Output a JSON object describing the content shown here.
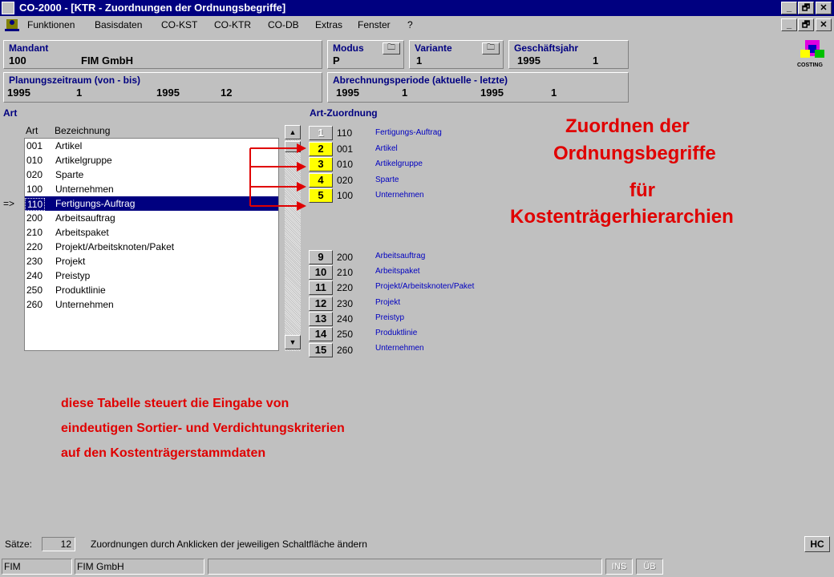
{
  "window": {
    "title": "CO-2000 - [KTR - Zuordnungen der Ordnungsbegriffe]",
    "min": "_",
    "max": "🗗",
    "close": "✕"
  },
  "menu": [
    "Funktionen",
    "Basisdaten",
    "CO-KST",
    "CO-KTR",
    "CO-DB",
    "Extras",
    "Fenster",
    "?"
  ],
  "header": {
    "mandant_label": "Mandant",
    "mandant_id": "100",
    "mandant_name": "FIM GmbH",
    "modus_label": "Modus",
    "modus_value": "P",
    "variante_label": "Variante",
    "variante_value": "1",
    "gj_label": "Geschäftsjahr",
    "gj_year": "1995",
    "gj_value": "1",
    "pz_label": "Planungszeitraum (von - bis)",
    "pz_from_year": "1995",
    "pz_from": "1",
    "pz_to_year": "1995",
    "pz_to": "12",
    "ap_label": "Abrechnungsperiode (aktuelle - letzte)",
    "ap_cur_year": "1995",
    "ap_cur": "1",
    "ap_last_year": "1995",
    "ap_last": "1",
    "logo_text": "COSTING"
  },
  "art": {
    "label": "Art",
    "col_art": "Art",
    "col_bez": "Bezeichnung",
    "marker": "=>",
    "rows": [
      {
        "code": "001",
        "name": "Artikel"
      },
      {
        "code": "010",
        "name": "Artikelgruppe"
      },
      {
        "code": "020",
        "name": "Sparte"
      },
      {
        "code": "100",
        "name": "Unternehmen"
      },
      {
        "code": "110",
        "name": "Fertigungs-Auftrag"
      },
      {
        "code": "200",
        "name": "Arbeitsauftrag"
      },
      {
        "code": "210",
        "name": "Arbeitspaket"
      },
      {
        "code": "220",
        "name": "Projekt/Arbeitsknoten/Paket"
      },
      {
        "code": "230",
        "name": "Projekt"
      },
      {
        "code": "240",
        "name": "Preistyp"
      },
      {
        "code": "250",
        "name": "Produktlinie"
      },
      {
        "code": "260",
        "name": "Unternehmen"
      }
    ]
  },
  "zuordnung": {
    "label": "Art-Zuordnung",
    "top": [
      {
        "num": "1",
        "code": "110",
        "name": "Fertigungs-Auftrag"
      },
      {
        "num": "2",
        "code": "001",
        "name": "Artikel"
      },
      {
        "num": "3",
        "code": "010",
        "name": "Artikelgruppe"
      },
      {
        "num": "4",
        "code": "020",
        "name": "Sparte"
      },
      {
        "num": "5",
        "code": "100",
        "name": "Unternehmen"
      }
    ],
    "bottom": [
      {
        "num": "9",
        "code": "200",
        "name": "Arbeitsauftrag"
      },
      {
        "num": "10",
        "code": "210",
        "name": "Arbeitspaket"
      },
      {
        "num": "11",
        "code": "220",
        "name": "Projekt/Arbeitsknoten/Paket"
      },
      {
        "num": "12",
        "code": "230",
        "name": "Projekt"
      },
      {
        "num": "13",
        "code": "240",
        "name": "Preistyp"
      },
      {
        "num": "14",
        "code": "250",
        "name": "Produktlinie"
      },
      {
        "num": "15",
        "code": "260",
        "name": "Unternehmen"
      }
    ]
  },
  "annotation": {
    "line1": "Zuordnen der",
    "line2": "Ordnungsbegriffe",
    "line3": "für",
    "line4": "Kostenträgerhierarchien",
    "note1": "diese Tabelle steuert die Eingabe von",
    "note2": "eindeutigen Sortier- und Verdichtungskriterien",
    "note3": "auf den Kostenträgerstammdaten"
  },
  "status": {
    "saetze_label": "Sätze:",
    "saetze_value": "12",
    "message": "Zuordnungen durch Anklicken der jeweiligen Schaltfläche ändern",
    "hc": "HC",
    "user": "FIM",
    "company": "FIM GmbH",
    "ins": "INS",
    "ub": "ÜB"
  }
}
